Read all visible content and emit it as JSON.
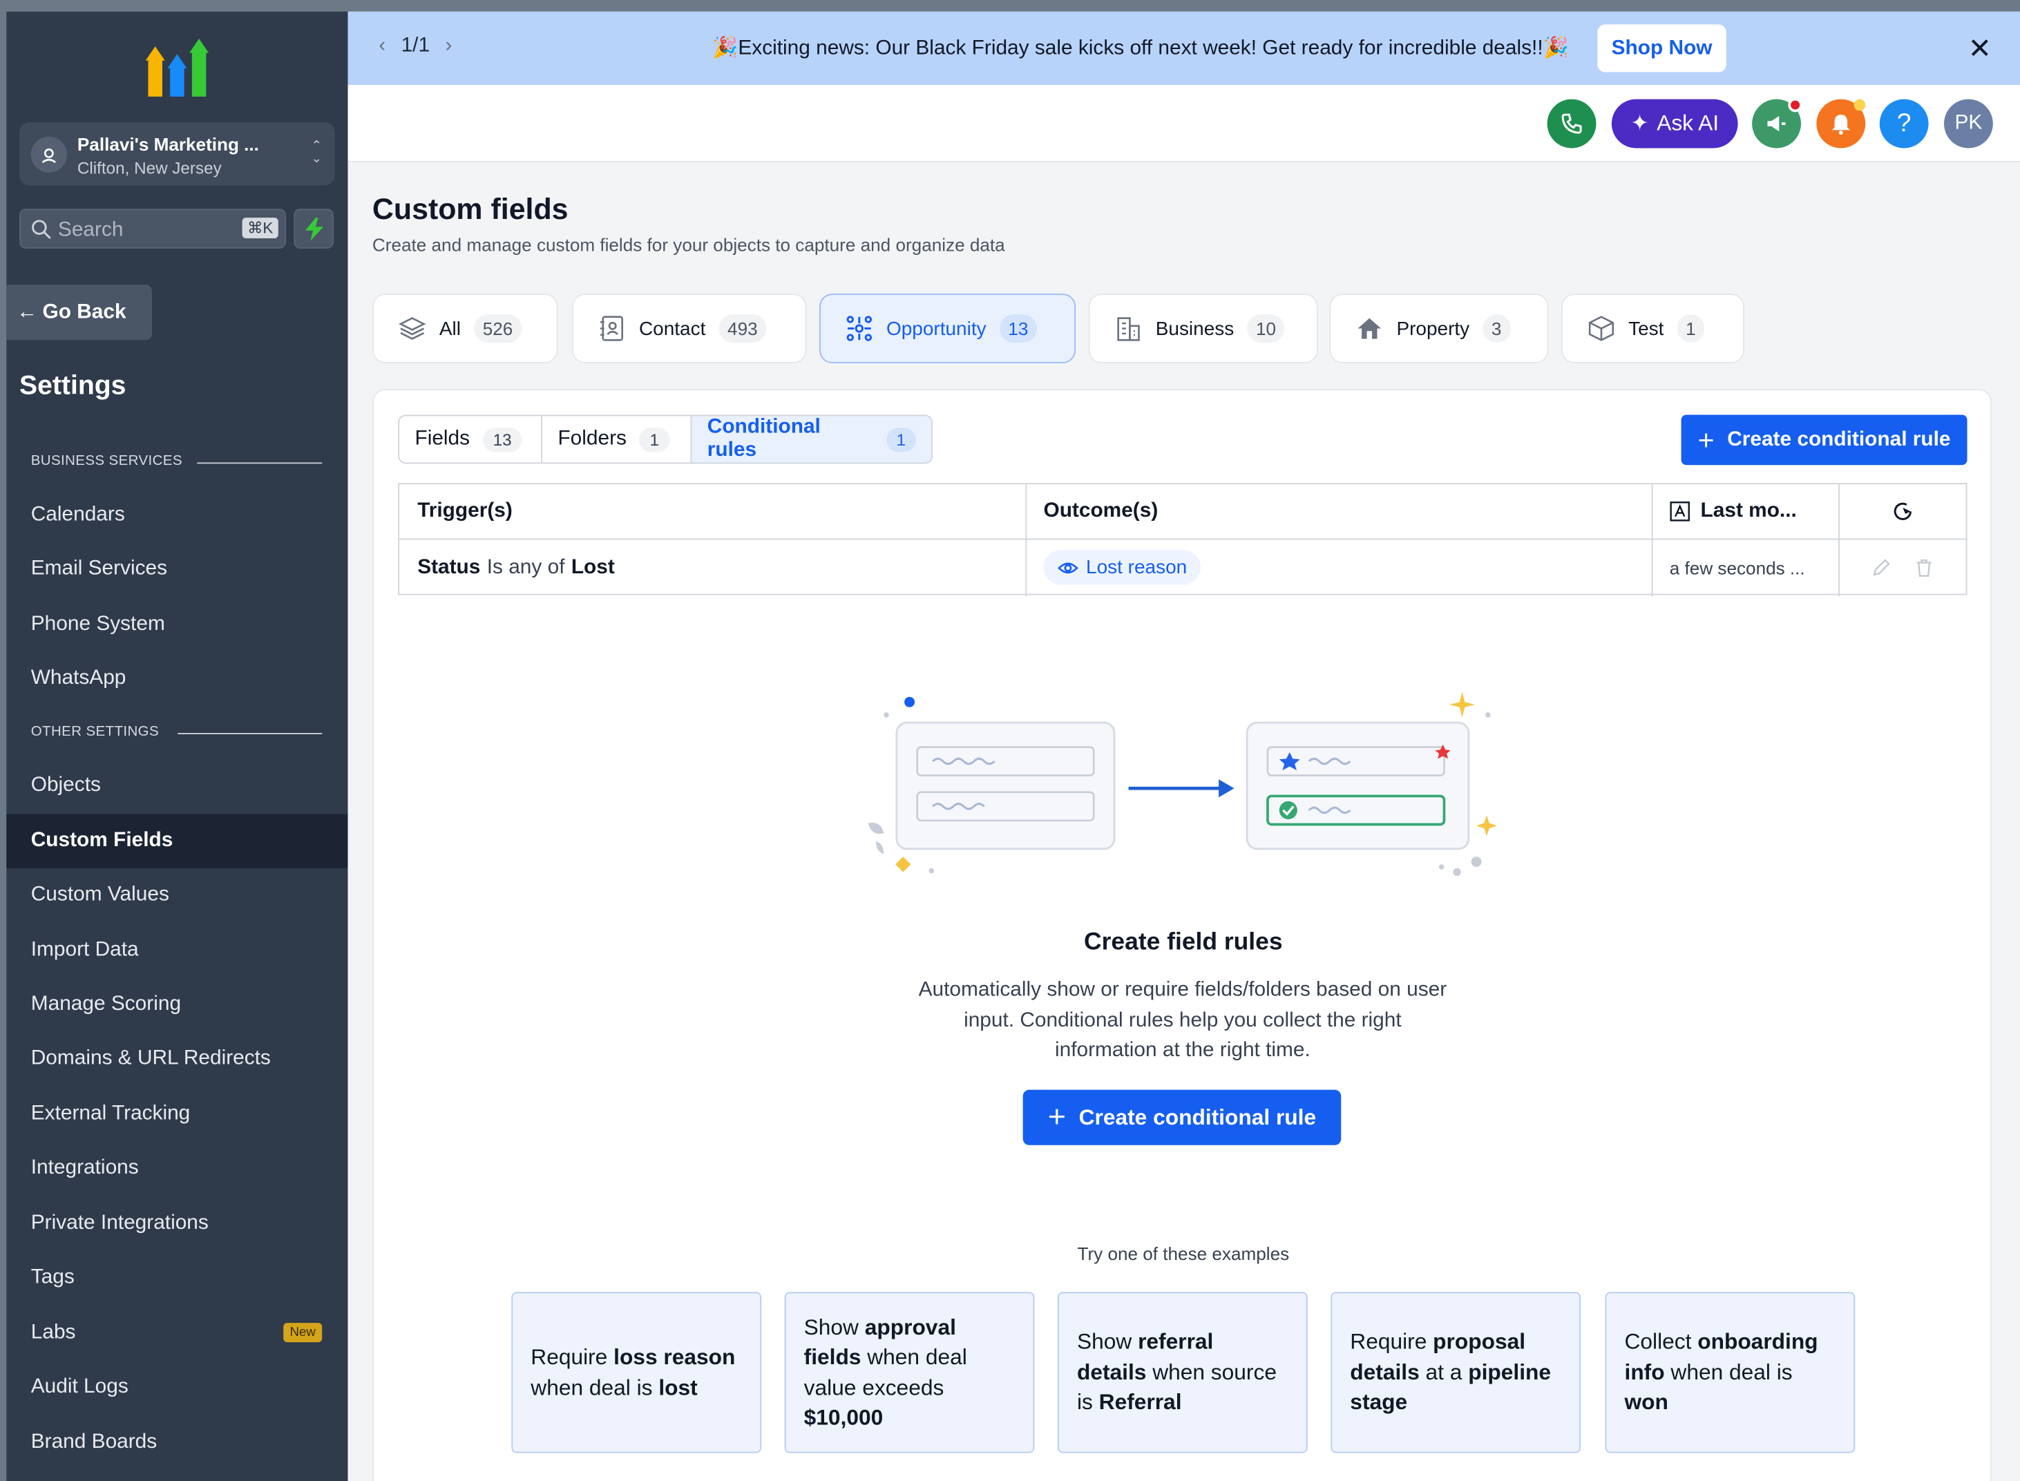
{
  "sidebar": {
    "account": {
      "name": "Pallavi's Marketing ...",
      "location": "Clifton, New Jersey"
    },
    "search": {
      "placeholder": "Search",
      "shortcut": "⌘K"
    },
    "go_back": "Go Back",
    "title": "Settings",
    "sections": [
      {
        "label": "BUSINESS SERVICES",
        "items": [
          "Calendars",
          "Email Services",
          "Phone System",
          "WhatsApp"
        ]
      },
      {
        "label": "OTHER SETTINGS",
        "items": [
          "Objects",
          "Custom Fields",
          "Custom Values",
          "Import Data",
          "Manage Scoring",
          "Domains & URL Redirects",
          "External Tracking",
          "Integrations",
          "Private Integrations",
          "Tags",
          "Labs",
          "Audit Logs",
          "Brand Boards"
        ]
      }
    ],
    "active_item": "Custom Fields",
    "labs_badge": "New"
  },
  "banner": {
    "pager": "1/1",
    "message": "🎉Exciting news: Our Black Friday sale kicks off next week! Get ready for incredible deals!!🎉",
    "cta": "Shop Now"
  },
  "topbar": {
    "ask_ai": "Ask AI",
    "help": "?",
    "avatar_initials": "PK"
  },
  "page": {
    "title": "Custom fields",
    "subtitle": "Create and manage custom fields for your objects to capture and organize data"
  },
  "object_tabs": [
    {
      "label": "All",
      "count": "526",
      "icon": "layers-icon"
    },
    {
      "label": "Contact",
      "count": "493",
      "icon": "contact-book-icon"
    },
    {
      "label": "Opportunity",
      "count": "13",
      "icon": "opportunity-icon",
      "active": true
    },
    {
      "label": "Business",
      "count": "10",
      "icon": "building-icon"
    },
    {
      "label": "Property",
      "count": "3",
      "icon": "house-icon"
    },
    {
      "label": "Test",
      "count": "1",
      "icon": "cube-icon"
    }
  ],
  "sub_tabs": [
    {
      "label": "Fields",
      "count": "13"
    },
    {
      "label": "Folders",
      "count": "1"
    },
    {
      "label": "Conditional rules",
      "count": "1",
      "active": true
    }
  ],
  "create_rule_label": "Create conditional rule",
  "table": {
    "headers": [
      "Trigger(s)",
      "Outcome(s)",
      "Last mo..."
    ],
    "row": {
      "trigger_field": "Status",
      "trigger_op": "Is any of",
      "trigger_value": "Lost",
      "outcome": "Lost reason",
      "last_modified": "a few seconds ..."
    }
  },
  "empty_state": {
    "title": "Create field rules",
    "description": "Automatically show or require fields/folders based on user input. Conditional rules help you collect the right information at the right time.",
    "cta": "Create conditional rule",
    "examples_label": "Try one of these examples"
  },
  "examples": [
    {
      "pre": "Require ",
      "b1": "loss reason",
      "mid": " when deal is ",
      "b2": "lost",
      "post": ""
    },
    {
      "pre": "Show ",
      "b1": "approval fields",
      "mid": " when deal value exceeds ",
      "b2": "$10,000",
      "post": ""
    },
    {
      "pre": "Show ",
      "b1": "referral details",
      "mid": " when source is ",
      "b2": "Referral",
      "post": ""
    },
    {
      "pre": "Require ",
      "b1": "proposal details",
      "mid": " at a ",
      "b2": "pipeline stage",
      "post": ""
    },
    {
      "pre": "Collect ",
      "b1": "onboarding info",
      "mid": " when deal is ",
      "b2": "won",
      "post": ""
    }
  ],
  "colors": {
    "accent": "#155eef",
    "sidebar": "#2f3a4b",
    "banner": "#b8d3fa"
  }
}
